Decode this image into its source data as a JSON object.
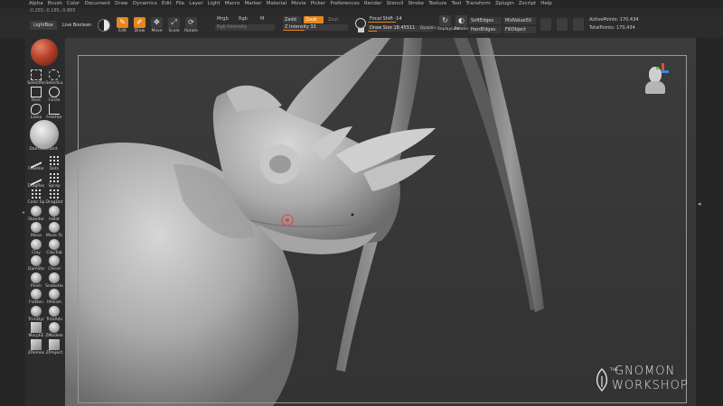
{
  "menu": [
    "Alpha",
    "Brush",
    "Color",
    "Document",
    "Draw",
    "Dynamics",
    "Edit",
    "File",
    "Layer",
    "Light",
    "Macro",
    "Marker",
    "Material",
    "Movie",
    "Picker",
    "Preferences",
    "Render",
    "Stencil",
    "Stroke",
    "Texture",
    "Tool",
    "Transform",
    "Zplugin",
    "Zscript",
    "Help"
  ],
  "coords": "-0.255,-0.185,-0.865",
  "toolbar": {
    "lightbox": "LightBox",
    "live_boolean": "Live Boolean",
    "tools": [
      {
        "label": "Edit",
        "active": true,
        "glyph": "✎"
      },
      {
        "label": "Draw",
        "active": true,
        "glyph": "✐"
      },
      {
        "label": "Move",
        "active": false,
        "glyph": "✥"
      },
      {
        "label": "Scale",
        "active": false,
        "glyph": "⤢"
      },
      {
        "label": "Rotate",
        "active": false,
        "glyph": "⟳"
      }
    ],
    "mrgb": "Mrgb",
    "rgb": "Rgb",
    "m": "M",
    "rgb_intensity": "Rgb Intensity",
    "zadd": "Zadd",
    "zsub": "Zsub",
    "zcut": "Zcut",
    "z_intensity": "Z Intensity 33",
    "z_intensity_value": 0.33,
    "focal_shift": "Focal Shift -14",
    "focal_shift_value": 0.43,
    "draw_size": "Draw Size 18.45511",
    "draw_size_value": 0.14,
    "dynamic": "Dynamic",
    "replay_last": "ReplayLast",
    "relativ": "Relativ",
    "soft_edges": "SoftEdges",
    "hard_edges": "HardEdges",
    "mid_value": "MidValue50",
    "fill_object": "FillObject",
    "active_points": "ActivePoints: 170,434",
    "total_points": "TotalPoints: 170,434"
  },
  "palette": [
    {
      "label": "SelectRe",
      "icon": "sel-rect"
    },
    {
      "label": "SelectLa",
      "icon": "sel-lasso"
    },
    {
      "label": "Rect",
      "icon": "rect"
    },
    {
      "label": "Circle",
      "icon": "circle"
    },
    {
      "label": "Lasso",
      "icon": "lasso"
    },
    {
      "label": "FreeHar",
      "icon": "free"
    },
    {
      "label": "DamStandard",
      "icon": "sphere"
    },
    {
      "label": "FreeHar",
      "icon": "stroke"
    },
    {
      "label": "Dots",
      "icon": "dots"
    },
    {
      "label": "DragRec",
      "icon": "stroke"
    },
    {
      "label": "Spray",
      "icon": "dots"
    },
    {
      "label": "Color Sp",
      "icon": "dots"
    },
    {
      "label": "DragDot",
      "icon": "dots"
    },
    {
      "label": "Standar",
      "icon": "sphere"
    },
    {
      "label": "InBat",
      "icon": "sphere"
    },
    {
      "label": "Move",
      "icon": "sphere"
    },
    {
      "label": "Move To",
      "icon": "sphere"
    },
    {
      "label": "Clay",
      "icon": "sphere"
    },
    {
      "label": "ClayTub",
      "icon": "sphere"
    },
    {
      "label": "DamSta",
      "icon": "sphere"
    },
    {
      "label": "Chisel",
      "icon": "sphere"
    },
    {
      "label": "Pinch",
      "icon": "sphere"
    },
    {
      "label": "SnakeHo",
      "icon": "sphere"
    },
    {
      "label": "Flatten",
      "icon": "sphere"
    },
    {
      "label": "hPolish",
      "icon": "sphere"
    },
    {
      "label": "TrimDyr",
      "icon": "sphere"
    },
    {
      "label": "TrimAdv",
      "icon": "sphere"
    },
    {
      "label": "MorphE",
      "icon": "cube"
    },
    {
      "label": "ZModele",
      "icon": "sphere"
    },
    {
      "label": "ZRemes",
      "icon": "cube"
    },
    {
      "label": "ZProject",
      "icon": "cube"
    }
  ],
  "watermark": {
    "the": "THE",
    "line1": "GNOMON",
    "line2": "WORKSHOP"
  },
  "colors": {
    "accent": "#e8861c",
    "bg": "#2a2a2a",
    "viewport": "#383838",
    "model": "#b8b8b8"
  }
}
